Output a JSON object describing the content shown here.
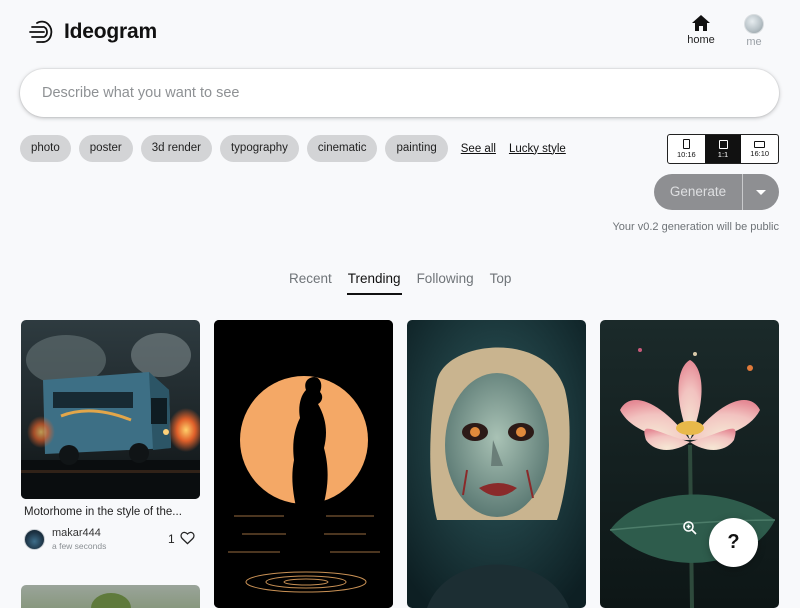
{
  "header": {
    "brand": "Ideogram",
    "nav": {
      "home_label": "home",
      "me_label": "me"
    }
  },
  "prompt": {
    "placeholder": "Describe what you want to see",
    "value": ""
  },
  "style_chips": [
    "photo",
    "poster",
    "3d render",
    "typography",
    "cinematic",
    "painting"
  ],
  "links": {
    "see_all": "See all",
    "lucky_style": "Lucky style"
  },
  "aspect_ratios": [
    {
      "label": "10:16",
      "selected": false
    },
    {
      "label": "1:1",
      "selected": true
    },
    {
      "label": "16:10",
      "selected": false
    }
  ],
  "generate": {
    "label": "Generate",
    "note": "Your v0.2 generation will be public"
  },
  "feed_tabs": [
    {
      "label": "Recent",
      "active": false
    },
    {
      "label": "Trending",
      "active": true
    },
    {
      "label": "Following",
      "active": false
    },
    {
      "label": "Top",
      "active": false
    }
  ],
  "cards": [
    {
      "caption": "Motorhome in the style of the...",
      "author": "makar444",
      "time": "a few seconds",
      "likes": "1"
    }
  ],
  "help": {
    "label": "?"
  },
  "colors": {
    "accent": "#111111",
    "chip_bg": "#d3d4d6",
    "generate_bg": "#8e8f92",
    "page_bg": "#f8f9fb"
  }
}
